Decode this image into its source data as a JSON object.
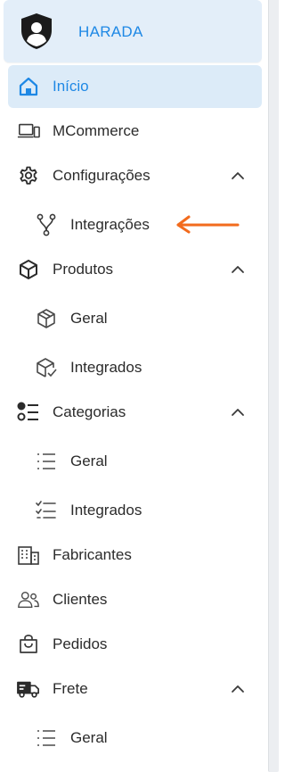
{
  "brand": {
    "name": "HARADA"
  },
  "colors": {
    "accent": "#1e88e5",
    "active_bg": "#dcebf8",
    "header_bg": "#e3eef9",
    "annotation_arrow": "#f26b1d"
  },
  "nav": {
    "inicio": {
      "label": "Início",
      "icon": "home-icon"
    },
    "mcommerce": {
      "label": "MCommerce",
      "icon": "devices-icon"
    },
    "configuracoes": {
      "label": "Configurações",
      "icon": "gear-icon",
      "expanded": true
    },
    "integracoes": {
      "label": "Integrações",
      "icon": "integration-icon"
    },
    "produtos": {
      "label": "Produtos",
      "icon": "box-icon",
      "expanded": true
    },
    "produtos_geral": {
      "label": "Geral",
      "icon": "box-outline-icon"
    },
    "produtos_integrados": {
      "label": "Integrados",
      "icon": "box-check-icon"
    },
    "categorias": {
      "label": "Categorias",
      "icon": "category-list-icon",
      "expanded": true
    },
    "categorias_geral": {
      "label": "Geral",
      "icon": "list-icon"
    },
    "categorias_integrados": {
      "label": "Integrados",
      "icon": "checklist-icon"
    },
    "fabricantes": {
      "label": "Fabricantes",
      "icon": "building-icon"
    },
    "clientes": {
      "label": "Clientes",
      "icon": "users-icon"
    },
    "pedidos": {
      "label": "Pedidos",
      "icon": "shopping-bag-icon"
    },
    "frete": {
      "label": "Frete",
      "icon": "truck-icon",
      "expanded": true
    },
    "frete_geral": {
      "label": "Geral",
      "icon": "list-icon"
    }
  }
}
